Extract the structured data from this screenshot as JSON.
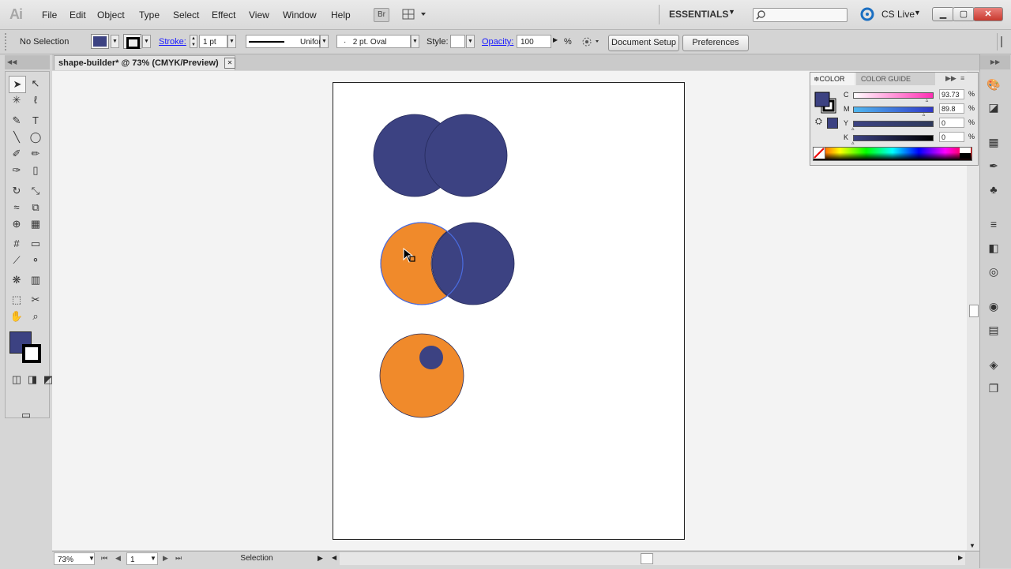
{
  "app": {
    "logo": "Ai"
  },
  "menu": [
    "File",
    "Edit",
    "Object",
    "Type",
    "Select",
    "Effect",
    "View",
    "Window",
    "Help"
  ],
  "bridge_label": "Br",
  "workspace": "ESSENTIALS",
  "cs_live": "CS Live",
  "control": {
    "selection": "No Selection",
    "stroke_label": "Stroke:",
    "stroke_weight": "1 pt",
    "profile": "Uniform",
    "brush": "2 pt. Oval",
    "brush_prefix": "·",
    "style_label": "Style:",
    "opacity_label": "Opacity:",
    "opacity_value": "100",
    "percent": "%",
    "doc_setup": "Document Setup",
    "preferences": "Preferences"
  },
  "document": {
    "tab_title": "shape-builder* @ 73% (CMYK/Preview)",
    "close": "✕"
  },
  "status": {
    "zoom": "73%",
    "page": "1",
    "mode": "Selection"
  },
  "color_panel": {
    "tab_color": "COLOR",
    "tab_guide": "COLOR GUIDE",
    "channels": [
      {
        "name": "C",
        "value": "93.73",
        "unit": "%",
        "level": 0.9373
      },
      {
        "name": "M",
        "value": "89.8",
        "unit": "%",
        "level": 0.898
      },
      {
        "name": "Y",
        "value": "0",
        "unit": "%",
        "level": 0
      },
      {
        "name": "K",
        "value": "0",
        "unit": "%",
        "level": 0
      }
    ]
  },
  "colors": {
    "fill": "#3c4282",
    "orange": "#f08a2b",
    "accent": "#1a1aff"
  }
}
